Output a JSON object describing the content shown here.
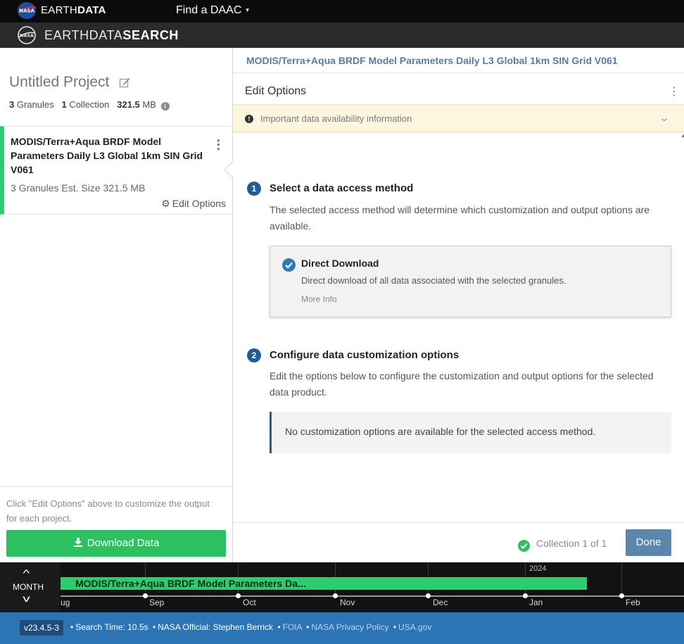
{
  "topbar": {
    "brand_light": "EARTH",
    "brand_bold": "DATA",
    "daac_label": "Find a DAAC",
    "daac_caret": "▾"
  },
  "searchbar": {
    "brand_light": "EARTHDATA",
    "brand_bold": "SEARCH"
  },
  "project": {
    "title": "Untitled Project",
    "granules_count": "3",
    "granules_label": "Granules",
    "collections_count": "1",
    "collections_label": "Collection",
    "size_value": "321.5",
    "size_unit": "MB"
  },
  "collection_card": {
    "title": "MODIS/Terra+Aqua BRDF Model Parameters Daily L3 Global 1km SIN Grid V061",
    "meta": "3 Granules  Est. Size 321.5 MB",
    "edit_label": "Edit Options"
  },
  "sidebar_footer": {
    "hint": "Click \"Edit Options\" above to customize the output for each project.",
    "download_label": "Download Data"
  },
  "main": {
    "collection_title": "MODIS/Terra+Aqua BRDF Model Parameters Daily L3 Global 1km SIN Grid V061",
    "options_title": "Edit Options",
    "notice_text": "Important data availability information",
    "step1": {
      "number": "1",
      "title": "Select a data access method",
      "description": "The selected access method will determine which customization and output options are available."
    },
    "method": {
      "name": "Direct Download",
      "description": "Direct download of all data associated with the selected granules.",
      "more_info": "More Info"
    },
    "step2": {
      "number": "2",
      "title": "Configure data customization options",
      "description": "Edit the options below to configure the customization and output options for the selected data product."
    },
    "no_customization": "No customization options are available for the selected access method.",
    "collection_count": "Collection 1 of 1",
    "done_label": "Done"
  },
  "timeline": {
    "zoom_label": "MONTH",
    "bar_label": "MODIS/Terra+Aqua BRDF Model Parameters Da...",
    "year_label": "2024",
    "month_labels": [
      "ug",
      "Sep",
      "Oct",
      "Nov",
      "Dec",
      "Jan",
      "Feb"
    ]
  },
  "footer": {
    "version": "v23.4.5-3",
    "search_time": "Search Time: 10.5s",
    "official": "NASA Official: Stephen Berrick",
    "links": [
      "FOIA",
      "NASA Privacy Policy",
      "USA.gov"
    ]
  },
  "colors": {
    "accent_green": "#2ebf60",
    "accent_blue": "#1f5d93",
    "footer_blue": "#2c74b4",
    "done_button": "#5b87ad"
  }
}
